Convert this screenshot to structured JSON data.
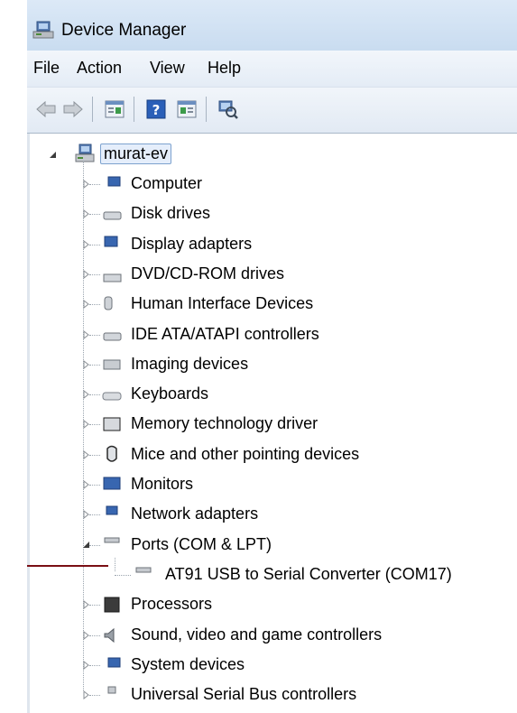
{
  "window": {
    "title": "Device Manager"
  },
  "menu": [
    "File",
    "Action",
    "View",
    "Help"
  ],
  "toolbar": [
    "back-icon",
    "forward-icon",
    "properties-icon",
    "help-icon",
    "show-hide-icon",
    "scan-hardware-icon"
  ],
  "tree": {
    "root": "murat-ev",
    "categories": [
      {
        "label": "Computer",
        "icon": "computer-icon"
      },
      {
        "label": "Disk drives",
        "icon": "disk-drive-icon"
      },
      {
        "label": "Display adapters",
        "icon": "display-adapter-icon"
      },
      {
        "label": "DVD/CD-ROM drives",
        "icon": "dvd-drive-icon"
      },
      {
        "label": "Human Interface Devices",
        "icon": "hid-icon"
      },
      {
        "label": "IDE ATA/ATAPI controllers",
        "icon": "ide-controller-icon"
      },
      {
        "label": "Imaging devices",
        "icon": "imaging-device-icon"
      },
      {
        "label": "Keyboards",
        "icon": "keyboard-icon"
      },
      {
        "label": "Memory technology driver",
        "icon": "memory-icon"
      },
      {
        "label": "Mice and other pointing devices",
        "icon": "mouse-icon"
      },
      {
        "label": "Monitors",
        "icon": "monitor-icon"
      },
      {
        "label": "Network adapters",
        "icon": "network-adapter-icon"
      },
      {
        "label": "Ports (COM & LPT)",
        "icon": "port-icon",
        "expanded": true,
        "children": [
          {
            "label": "AT91 USB to Serial Converter (COM17)",
            "icon": "port-icon"
          }
        ]
      },
      {
        "label": "Processors",
        "icon": "processor-icon"
      },
      {
        "label": "Sound, video and game controllers",
        "icon": "sound-icon"
      },
      {
        "label": "System devices",
        "icon": "system-device-icon"
      },
      {
        "label": "Universal Serial Bus controllers",
        "icon": "usb-icon"
      }
    ]
  }
}
